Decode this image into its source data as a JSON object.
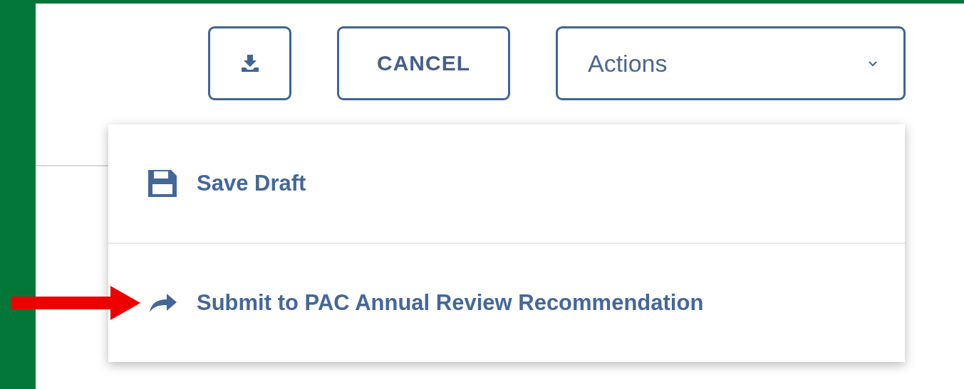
{
  "toolbar": {
    "cancel_button": {
      "label": "CANCEL"
    },
    "actions_dropdown": {
      "label": "Actions"
    }
  },
  "actions_menu": {
    "items": [
      {
        "label": "Save Draft",
        "kind": "save"
      },
      {
        "label": "Submit to PAC Annual Review Recommendation",
        "kind": "submit"
      }
    ]
  }
}
